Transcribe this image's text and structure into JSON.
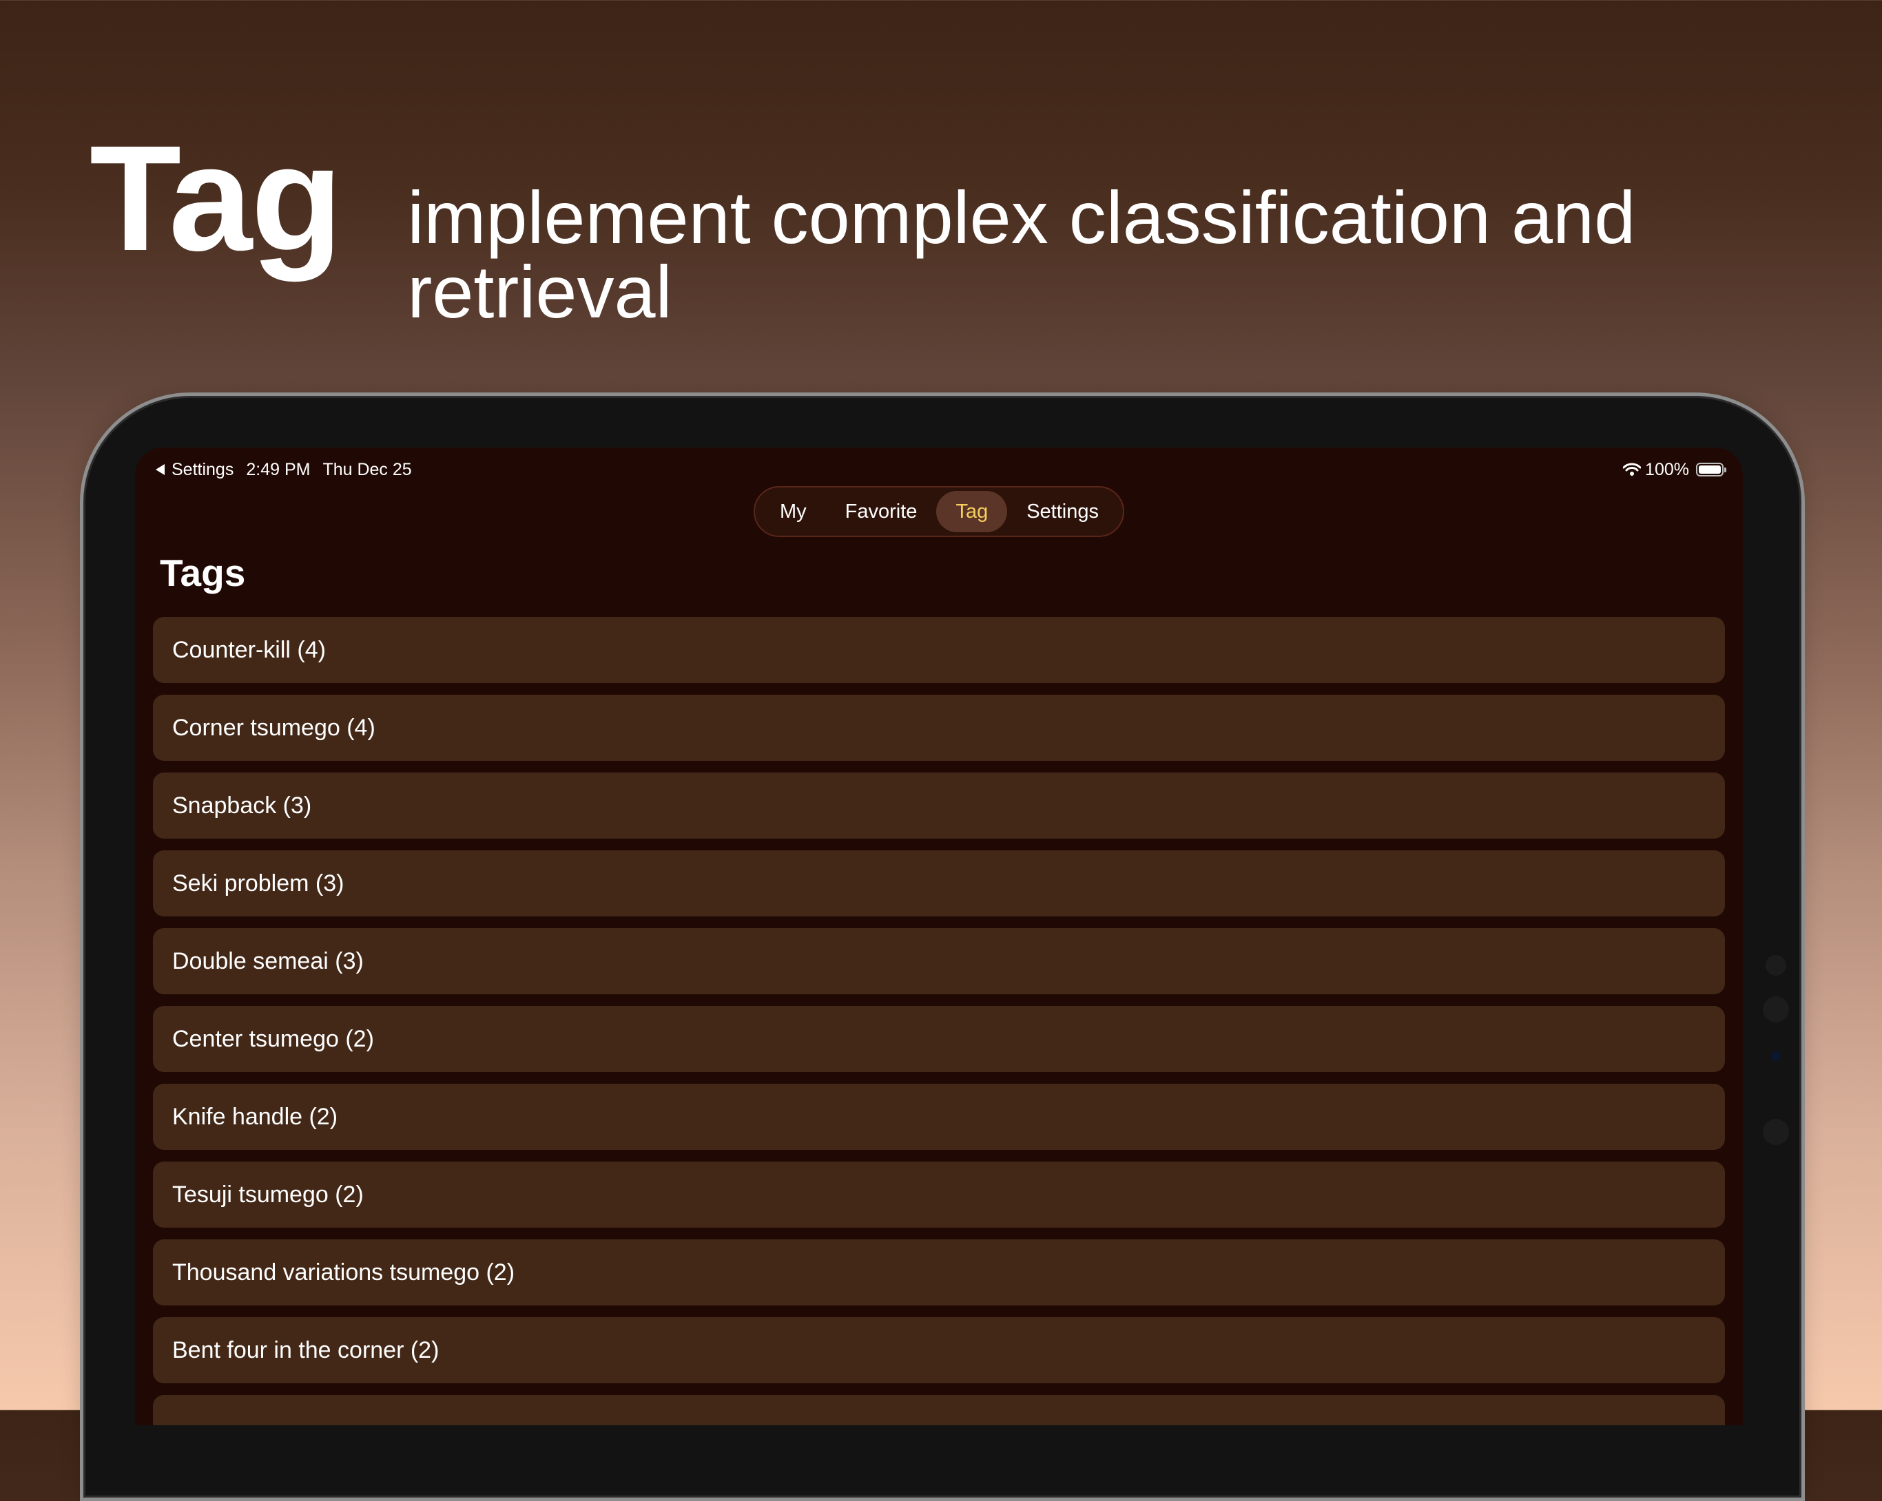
{
  "headline": {
    "title": "Tag",
    "subtitle": "implement complex classification and retrieval"
  },
  "status_bar": {
    "back_label": "Settings",
    "time": "2:49 PM",
    "date": "Thu Dec 25",
    "battery": "100%"
  },
  "tabs": [
    {
      "label": "My",
      "active": false
    },
    {
      "label": "Favorite",
      "active": false
    },
    {
      "label": "Tag",
      "active": true
    },
    {
      "label": "Settings",
      "active": false
    }
  ],
  "page_title": "Tags",
  "tags": [
    "Counter-kill (4)",
    "Corner tsumego (4)",
    "Snapback (3)",
    "Seki problem (3)",
    "Double semeai (3)",
    "Center tsumego (2)",
    "Knife handle (2)",
    "Tesuji tsumego (2)",
    "Thousand variations tsumego (2)",
    "Bent four in the corner (2)",
    ""
  ],
  "colors": {
    "accent": "#f6cf5d",
    "screen_background": "#200904",
    "row_background": "#432818"
  }
}
